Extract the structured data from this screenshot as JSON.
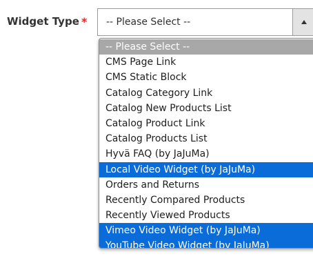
{
  "field": {
    "label": "Widget Type",
    "required_mark": "*"
  },
  "select": {
    "current_value": "-- Please Select --",
    "arrow_icon": "triangle-up-icon"
  },
  "dropdown": {
    "options": [
      {
        "label": "-- Please Select --",
        "state": "placeholder"
      },
      {
        "label": "CMS Page Link",
        "state": "normal"
      },
      {
        "label": "CMS Static Block",
        "state": "normal"
      },
      {
        "label": "Catalog Category Link",
        "state": "normal"
      },
      {
        "label": "Catalog New Products List",
        "state": "normal"
      },
      {
        "label": "Catalog Product Link",
        "state": "normal"
      },
      {
        "label": "Catalog Products List",
        "state": "normal"
      },
      {
        "label": "Hyvä FAQ (by JaJuMa)",
        "state": "normal"
      },
      {
        "label": "Local Video Widget (by JaJuMa)",
        "state": "highlighted"
      },
      {
        "label": "Orders and Returns",
        "state": "normal"
      },
      {
        "label": "Recently Compared Products",
        "state": "normal"
      },
      {
        "label": "Recently Viewed Products",
        "state": "normal"
      },
      {
        "label": "Vimeo Video Widget (by JaJuMa)",
        "state": "highlighted"
      },
      {
        "label": "YouTube Video Widget (by JaJuMa)",
        "state": "highlighted"
      }
    ]
  },
  "colors": {
    "highlight": "#0a6cd8",
    "placeholder_bg": "#a8a8a8",
    "required": "#e22626",
    "label_text": "#333333"
  }
}
